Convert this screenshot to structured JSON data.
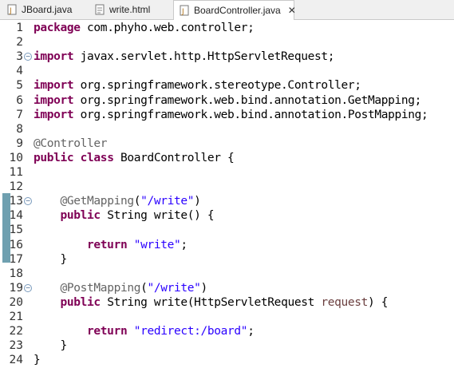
{
  "tabs": [
    {
      "label": "JBoard.java",
      "icon": "java-file-icon",
      "active": false
    },
    {
      "label": "write.html",
      "icon": "html-file-icon",
      "active": false
    },
    {
      "label": "BoardController.java",
      "icon": "java-file-icon",
      "active": true,
      "close": "✕"
    }
  ],
  "lines": [
    {
      "num": "1",
      "fold": false,
      "tokens": [
        {
          "t": "package",
          "c": "kw"
        },
        {
          "t": " com.phyho.web.controller;",
          "c": ""
        }
      ]
    },
    {
      "num": "2",
      "fold": false,
      "tokens": []
    },
    {
      "num": "3",
      "fold": true,
      "tokens": [
        {
          "t": "import",
          "c": "kw"
        },
        {
          "t": " javax.servlet.http.HttpServletRequest;",
          "c": ""
        }
      ]
    },
    {
      "num": "4",
      "fold": false,
      "tokens": []
    },
    {
      "num": "5",
      "fold": false,
      "tokens": [
        {
          "t": "import",
          "c": "kw"
        },
        {
          "t": " org.springframework.stereotype.Controller;",
          "c": ""
        }
      ]
    },
    {
      "num": "6",
      "fold": false,
      "tokens": [
        {
          "t": "import",
          "c": "kw"
        },
        {
          "t": " org.springframework.web.bind.annotation.GetMapping;",
          "c": ""
        }
      ]
    },
    {
      "num": "7",
      "fold": false,
      "tokens": [
        {
          "t": "import",
          "c": "kw"
        },
        {
          "t": " org.springframework.web.bind.annotation.PostMapping;",
          "c": ""
        }
      ]
    },
    {
      "num": "8",
      "fold": false,
      "tokens": []
    },
    {
      "num": "9",
      "fold": false,
      "tokens": [
        {
          "t": "@Controller",
          "c": "ann"
        }
      ]
    },
    {
      "num": "10",
      "fold": false,
      "tokens": [
        {
          "t": "public",
          "c": "kw"
        },
        {
          "t": " ",
          "c": ""
        },
        {
          "t": "class",
          "c": "kw"
        },
        {
          "t": " BoardController {",
          "c": ""
        }
      ]
    },
    {
      "num": "11",
      "fold": false,
      "tokens": []
    },
    {
      "num": "12",
      "fold": false,
      "tokens": []
    },
    {
      "num": "13",
      "fold": true,
      "tokens": [
        {
          "t": "    ",
          "c": ""
        },
        {
          "t": "@GetMapping",
          "c": "ann"
        },
        {
          "t": "(",
          "c": ""
        },
        {
          "t": "\"/write\"",
          "c": "str"
        },
        {
          "t": ")",
          "c": ""
        }
      ]
    },
    {
      "num": "14",
      "fold": false,
      "tokens": [
        {
          "t": "    ",
          "c": ""
        },
        {
          "t": "public",
          "c": "kw"
        },
        {
          "t": " String write() {",
          "c": ""
        }
      ]
    },
    {
      "num": "15",
      "fold": false,
      "tokens": []
    },
    {
      "num": "16",
      "fold": false,
      "tokens": [
        {
          "t": "        ",
          "c": ""
        },
        {
          "t": "return",
          "c": "kw"
        },
        {
          "t": " ",
          "c": ""
        },
        {
          "t": "\"write\"",
          "c": "str"
        },
        {
          "t": ";",
          "c": ""
        }
      ]
    },
    {
      "num": "17",
      "fold": false,
      "tokens": [
        {
          "t": "    }",
          "c": ""
        }
      ]
    },
    {
      "num": "18",
      "fold": false,
      "tokens": []
    },
    {
      "num": "19",
      "fold": true,
      "tokens": [
        {
          "t": "    ",
          "c": ""
        },
        {
          "t": "@PostMapping",
          "c": "ann"
        },
        {
          "t": "(",
          "c": ""
        },
        {
          "t": "\"/write\"",
          "c": "str"
        },
        {
          "t": ")",
          "c": ""
        }
      ]
    },
    {
      "num": "20",
      "fold": false,
      "tokens": [
        {
          "t": "    ",
          "c": ""
        },
        {
          "t": "public",
          "c": "kw"
        },
        {
          "t": " String write(HttpServletRequest ",
          "c": ""
        },
        {
          "t": "request",
          "c": "vn"
        },
        {
          "t": ") {",
          "c": ""
        }
      ]
    },
    {
      "num": "21",
      "fold": false,
      "tokens": []
    },
    {
      "num": "22",
      "fold": false,
      "tokens": [
        {
          "t": "        ",
          "c": ""
        },
        {
          "t": "return",
          "c": "kw"
        },
        {
          "t": " ",
          "c": ""
        },
        {
          "t": "\"redirect:/board\"",
          "c": "str"
        },
        {
          "t": ";",
          "c": ""
        }
      ]
    },
    {
      "num": "23",
      "fold": false,
      "tokens": [
        {
          "t": "    }",
          "c": ""
        }
      ]
    },
    {
      "num": "24",
      "fold": false,
      "tokens": [
        {
          "t": "}",
          "c": ""
        }
      ]
    }
  ],
  "change_marker_lines": [
    "13",
    "17"
  ],
  "colors": {
    "keyword": "#7f0055",
    "string": "#2a00ff",
    "annotation": "#646464",
    "variable": "#6a3e3e",
    "change_marker": "#6fa0b0"
  }
}
